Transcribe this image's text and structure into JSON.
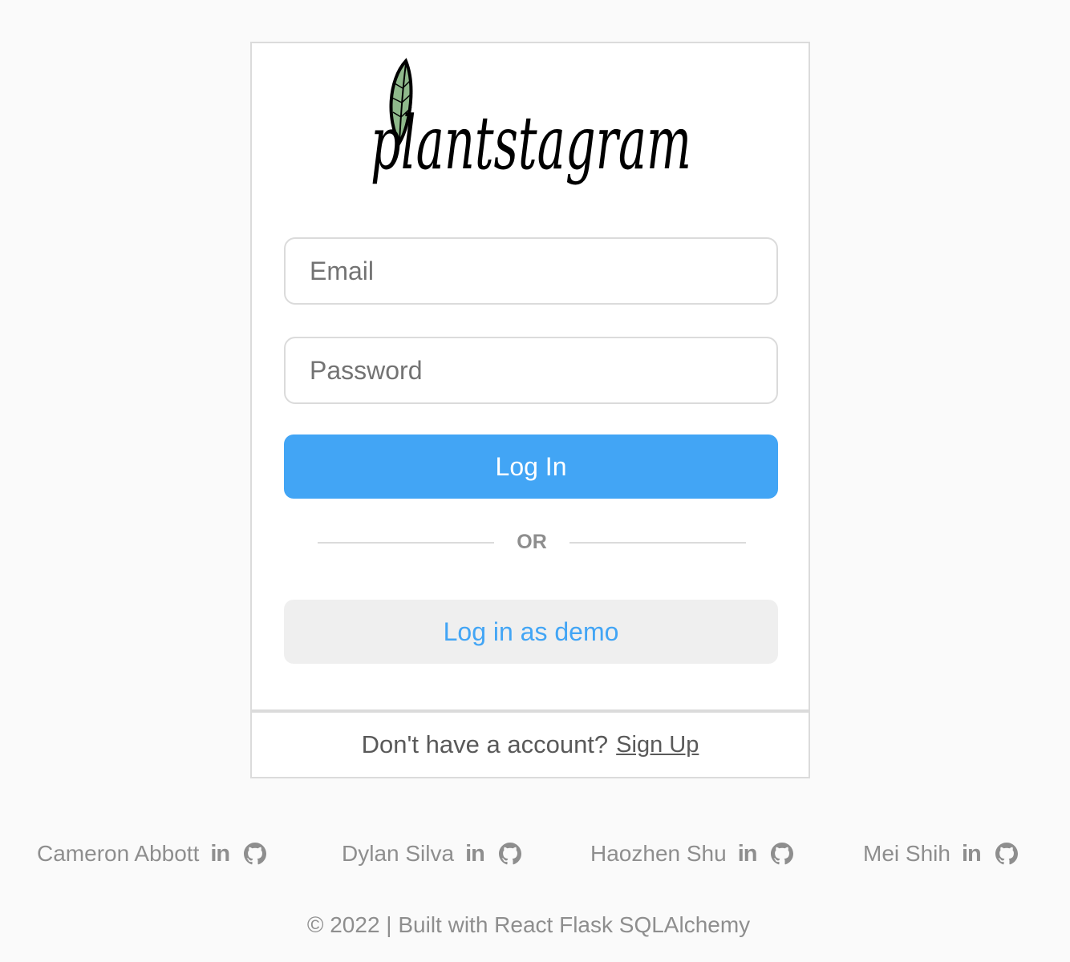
{
  "app": {
    "logo_text": "plantstagram"
  },
  "login_form": {
    "email_placeholder": "Email",
    "password_placeholder": "Password",
    "login_button": "Log In",
    "divider_text": "OR",
    "demo_button": "Log in as demo"
  },
  "signup": {
    "prompt": "Don't have a account?",
    "link": "Sign Up"
  },
  "footer": {
    "people": [
      {
        "name": "Cameron Abbott",
        "linkedin_icon": "linkedin-icon",
        "github_icon": "github-icon"
      },
      {
        "name": "Dylan Silva",
        "linkedin_icon": "linkedin-icon",
        "github_icon": "github-icon"
      },
      {
        "name": "Haozhen Shu",
        "linkedin_icon": "linkedin-icon",
        "github_icon": "github-icon"
      },
      {
        "name": "Mei Shih",
        "linkedin_icon": "linkedin-icon",
        "github_icon": "github-icon"
      }
    ],
    "linkedin_glyph": "in",
    "copyright": "© 2022 | Built with React Flask SQLAlchemy"
  },
  "colors": {
    "primary": "#42a5f5",
    "background": "#fafafa",
    "border": "#dbdbdb",
    "muted_text": "#8e8e8e",
    "leaf_green": "#8fb98b"
  }
}
